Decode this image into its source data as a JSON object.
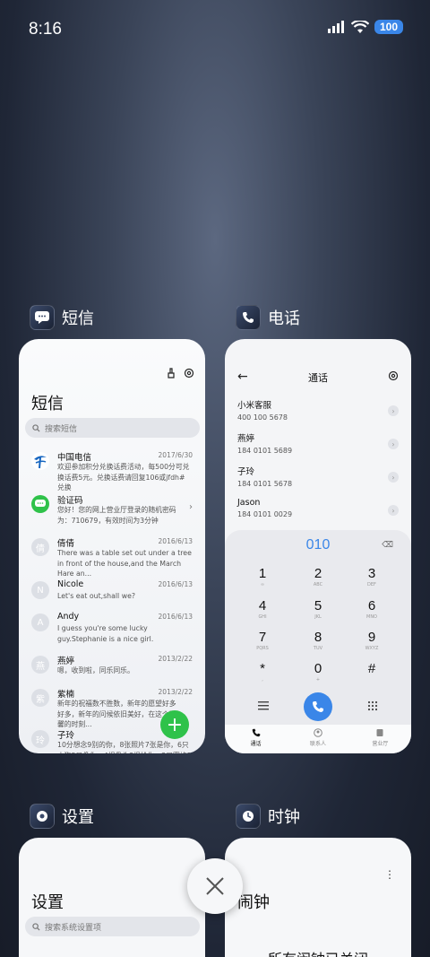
{
  "status": {
    "time": "8:16",
    "battery": "100"
  },
  "apps": {
    "sms": {
      "label": "短信",
      "title": "短信",
      "search_placeholder": "搜索短信",
      "messages": [
        {
          "name": "中国电信",
          "date": "2017/6/30",
          "text": "欢迎参加积分兑换话费活动，每500分可兑换话费5元。兑换话费请回复106或jfdh#兑换"
        },
        {
          "name": "验证码",
          "date": "",
          "text": "您好！您的网上营业厅登录的随机密码为：710679，有效时间为3分钟"
        },
        {
          "name": "倩倩",
          "date": "2016/6/13",
          "text": "There was a table set out under a tree in front of the house,and the March Hare an..."
        },
        {
          "name": "Nicole",
          "date": "2016/6/13",
          "text": "Let's eat out,shall we?"
        },
        {
          "name": "Andy",
          "date": "2016/6/13",
          "text": "I guess you're some lucky guy.Stephanie is a nice girl."
        },
        {
          "name": "燕婷",
          "date": "2013/2/22",
          "text": "嗯，收到啦，同乐同乐。"
        },
        {
          "name": "紫楠",
          "date": "2013/2/22",
          "text": "新年的祝福数不胜数，新年的愿望好多好多，新年的问候依旧美好，在这个温馨的时刻..."
        },
        {
          "name": "子玲",
          "date": "",
          "text": "10分想念9别的你，8张照片7张是你，6只小狗5只像你，4根骨头3根给你，2只蜜蜂1只..."
        }
      ],
      "avatars": [
        "",
        "",
        "倩",
        "N",
        "A",
        "燕",
        "紫",
        "玲"
      ]
    },
    "phone": {
      "label": "电话",
      "title": "通话",
      "contacts": [
        {
          "name": "小米客服",
          "number": "400 100 5678"
        },
        {
          "name": "燕婷",
          "number": "184 0101 5689"
        },
        {
          "name": "子玲",
          "number": "184 0101 5678"
        },
        {
          "name": "Jason",
          "number": "184 0101 0029"
        }
      ],
      "dial_input": "010",
      "keys": [
        {
          "d": "1",
          "l": "∞"
        },
        {
          "d": "2",
          "l": "ABC"
        },
        {
          "d": "3",
          "l": "DEF"
        },
        {
          "d": "4",
          "l": "GHI"
        },
        {
          "d": "5",
          "l": "JKL"
        },
        {
          "d": "6",
          "l": "MNO"
        },
        {
          "d": "7",
          "l": "PQRS"
        },
        {
          "d": "8",
          "l": "TUV"
        },
        {
          "d": "9",
          "l": "WXYZ"
        },
        {
          "d": "*",
          "l": ","
        },
        {
          "d": "0",
          "l": "+"
        },
        {
          "d": "#",
          "l": ""
        }
      ],
      "tabs": {
        "calls": "通话",
        "contacts": "联系人",
        "store": "营业厅"
      }
    },
    "settings": {
      "label": "设置",
      "title": "设置",
      "search_placeholder": "搜索系统设置项"
    },
    "clock": {
      "label": "时钟",
      "title": "闹钟",
      "empty": "所有闹钟已关闭"
    }
  },
  "colors": {
    "accent": "#3a86e8",
    "fab": "#2fc24a"
  }
}
